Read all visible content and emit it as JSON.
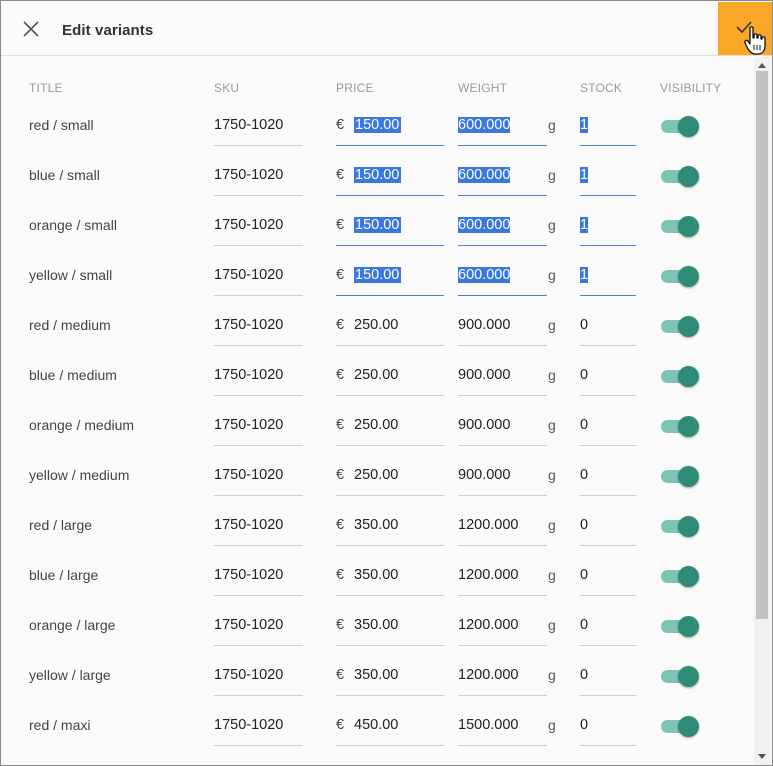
{
  "dialog": {
    "title": "Edit variants",
    "accent_color": "#f9a825"
  },
  "columns": {
    "title": "TITLE",
    "sku": "SKU",
    "price": "PRICE",
    "weight": "WEIGHT",
    "stock": "STOCK",
    "visibility": "VISIBILITY"
  },
  "currency_symbol": "€",
  "weight_unit": "g",
  "variants": [
    {
      "title": "red / small",
      "sku": "1750-1020",
      "price": "150.00",
      "weight": "600.000",
      "stock": "1",
      "visible": true,
      "selected": true
    },
    {
      "title": "blue / small",
      "sku": "1750-1020",
      "price": "150.00",
      "weight": "600.000",
      "stock": "1",
      "visible": true,
      "selected": true
    },
    {
      "title": "orange / small",
      "sku": "1750-1020",
      "price": "150.00",
      "weight": "600.000",
      "stock": "1",
      "visible": true,
      "selected": true
    },
    {
      "title": "yellow / small",
      "sku": "1750-1020",
      "price": "150.00",
      "weight": "600.000",
      "stock": "1",
      "visible": true,
      "selected": true
    },
    {
      "title": "red / medium",
      "sku": "1750-1020",
      "price": "250.00",
      "weight": "900.000",
      "stock": "0",
      "visible": true,
      "selected": false
    },
    {
      "title": "blue / medium",
      "sku": "1750-1020",
      "price": "250.00",
      "weight": "900.000",
      "stock": "0",
      "visible": true,
      "selected": false
    },
    {
      "title": "orange / medium",
      "sku": "1750-1020",
      "price": "250.00",
      "weight": "900.000",
      "stock": "0",
      "visible": true,
      "selected": false
    },
    {
      "title": "yellow / medium",
      "sku": "1750-1020",
      "price": "250.00",
      "weight": "900.000",
      "stock": "0",
      "visible": true,
      "selected": false
    },
    {
      "title": "red / large",
      "sku": "1750-1020",
      "price": "350.00",
      "weight": "1200.000",
      "stock": "0",
      "visible": true,
      "selected": false
    },
    {
      "title": "blue / large",
      "sku": "1750-1020",
      "price": "350.00",
      "weight": "1200.000",
      "stock": "0",
      "visible": true,
      "selected": false
    },
    {
      "title": "orange / large",
      "sku": "1750-1020",
      "price": "350.00",
      "weight": "1200.000",
      "stock": "0",
      "visible": true,
      "selected": false
    },
    {
      "title": "yellow / large",
      "sku": "1750-1020",
      "price": "350.00",
      "weight": "1200.000",
      "stock": "0",
      "visible": true,
      "selected": false
    },
    {
      "title": "red / maxi",
      "sku": "1750-1020",
      "price": "450.00",
      "weight": "1500.000",
      "stock": "0",
      "visible": true,
      "selected": false
    }
  ],
  "icons": {
    "close": "close-icon",
    "confirm": "check-icon",
    "cursor": "hand-pointer-icon"
  }
}
